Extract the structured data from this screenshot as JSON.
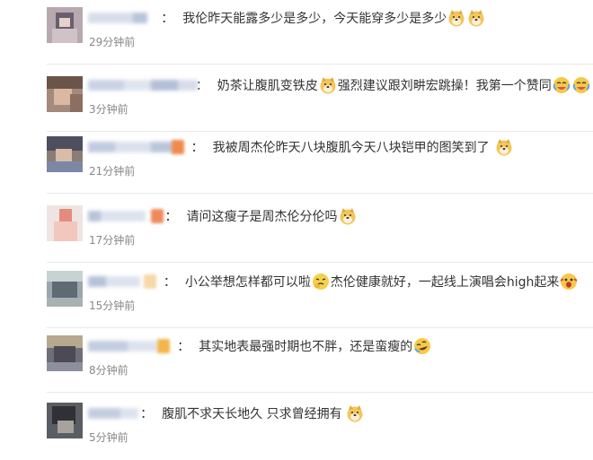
{
  "comments": [
    {
      "user": "用户一二",
      "text1": "我伦昨天能露多少是多少，今天能穿多少是多少",
      "text2": "",
      "text3": "",
      "time": "29分钟前"
    },
    {
      "user": "网友评论用户名",
      "text1": "奶茶让腹肌变铁皮",
      "text2": "强烈建议跟刘畊宏跳操！我第一个赞同",
      "text3": "",
      "time": "3分钟前"
    },
    {
      "user": "微博用户昵称",
      "text1": "我被周杰伦昨天八块腹肌今天八块铠甲的图笑到了",
      "text2": "",
      "text3": "",
      "time": "21分钟前"
    },
    {
      "user": "吴姓用户",
      "text1": "请问这瘦子是周杰伦分伦吗",
      "text2": "",
      "text3": "",
      "time": "17分钟前"
    },
    {
      "user": "用户名称",
      "text1": "小公举想怎样都可以啦",
      "text2": "杰伦健康就好，一起线上演唱会high起来",
      "text3": "",
      "time": "15分钟前"
    },
    {
      "user": "iuvyn用户",
      "text1": "其实地表最强时期也不胖，还是蛮瘦的",
      "text2": "",
      "text3": "",
      "time": "8分钟前"
    },
    {
      "user": "网友用户",
      "text1": "腹肌不求天长地久 只求曾经拥有",
      "text2": "",
      "text3": "",
      "time": "5分钟前"
    }
  ],
  "emoji_names": [
    "doge-emoji",
    "cry-laugh-emoji",
    "thinking-emoji",
    "laugh-roll-emoji",
    "shock-emoji"
  ]
}
